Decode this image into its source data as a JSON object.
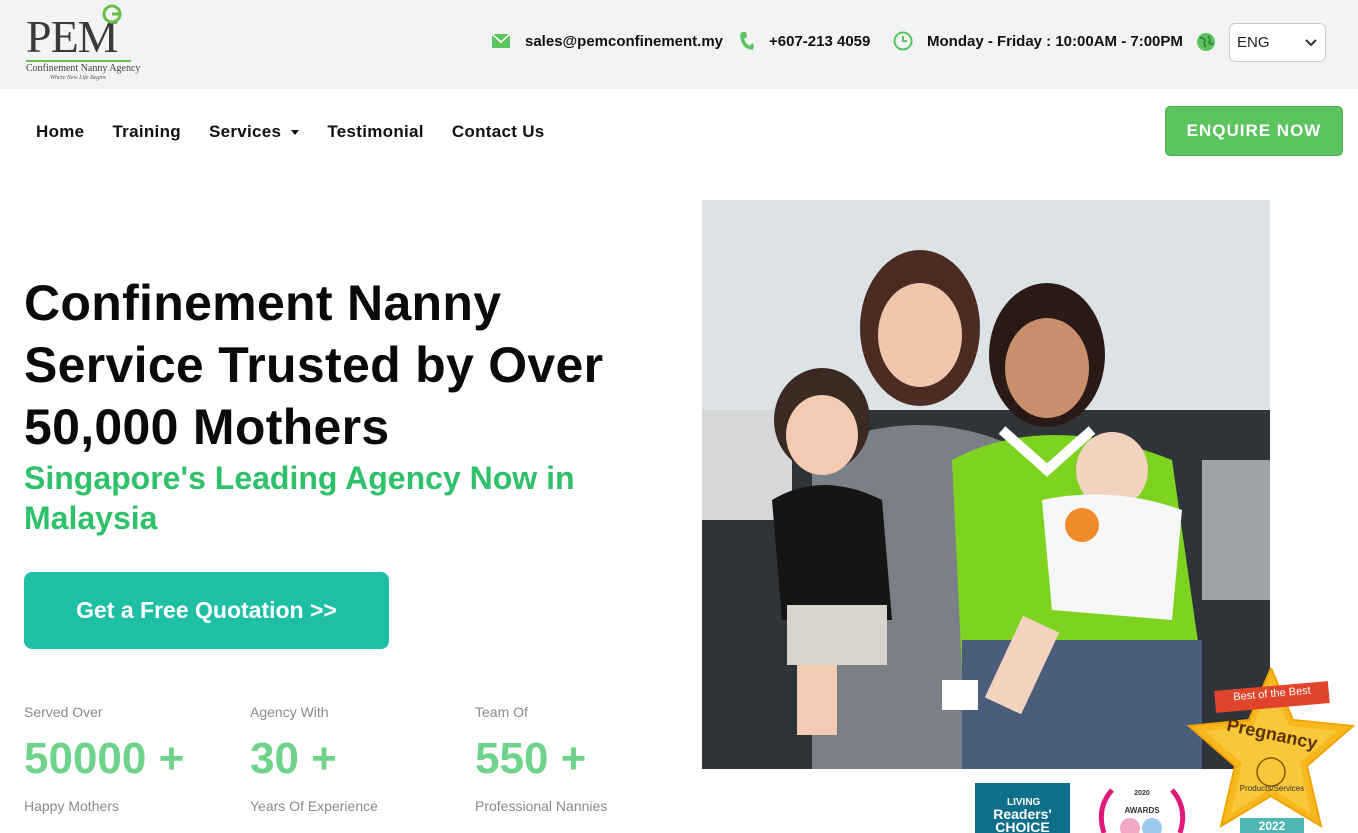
{
  "brand": {
    "logo_text": "PEM",
    "logo_subtitle": "Confinement Nanny Agency",
    "logo_tagline": "Where New Life Begins"
  },
  "topbar": {
    "email": "sales@pemconfinement.my",
    "phone": "+607-213 4059",
    "hours": "Monday - Friday : 10:00AM - 7:00PM",
    "language": "ENG",
    "icons": [
      "mail-icon",
      "phone-icon",
      "clock-icon",
      "globe-icon",
      "chevron-down-icon"
    ],
    "accent_color": "#5cc45f"
  },
  "nav": {
    "items": [
      {
        "label": "Home"
      },
      {
        "label": "Training"
      },
      {
        "label": "Services"
      },
      {
        "label": "Testimonial"
      },
      {
        "label": "Contact Us"
      }
    ],
    "cta_label": "ENQUIRE NOW"
  },
  "hero": {
    "headline": "Confinement Nanny Service Trusted by Over 50,000 Mothers",
    "subheadline": "Singapore's Leading Agency Now in Malaysia",
    "quote_button": "Get a Free Quotation >>",
    "stats": [
      {
        "top": "Served Over",
        "number": "50000 +",
        "bottom": "Happy Mothers"
      },
      {
        "top": "Agency With",
        "number": "30 +",
        "bottom": "Years Of Experience"
      },
      {
        "top": "Team Of",
        "number": "550 +",
        "bottom": "Professional Nannies"
      }
    ]
  },
  "badges": {
    "readers_choice": {
      "line1": "LIVING",
      "line2": "Readers'",
      "line3": "CHOICE"
    },
    "awards": {
      "year": "2020",
      "label": "AWARDS"
    },
    "best_of_best": {
      "ribbon": "Best of the Best",
      "title": "Pregnancy",
      "category": "Products/Services",
      "year": "2022"
    }
  }
}
